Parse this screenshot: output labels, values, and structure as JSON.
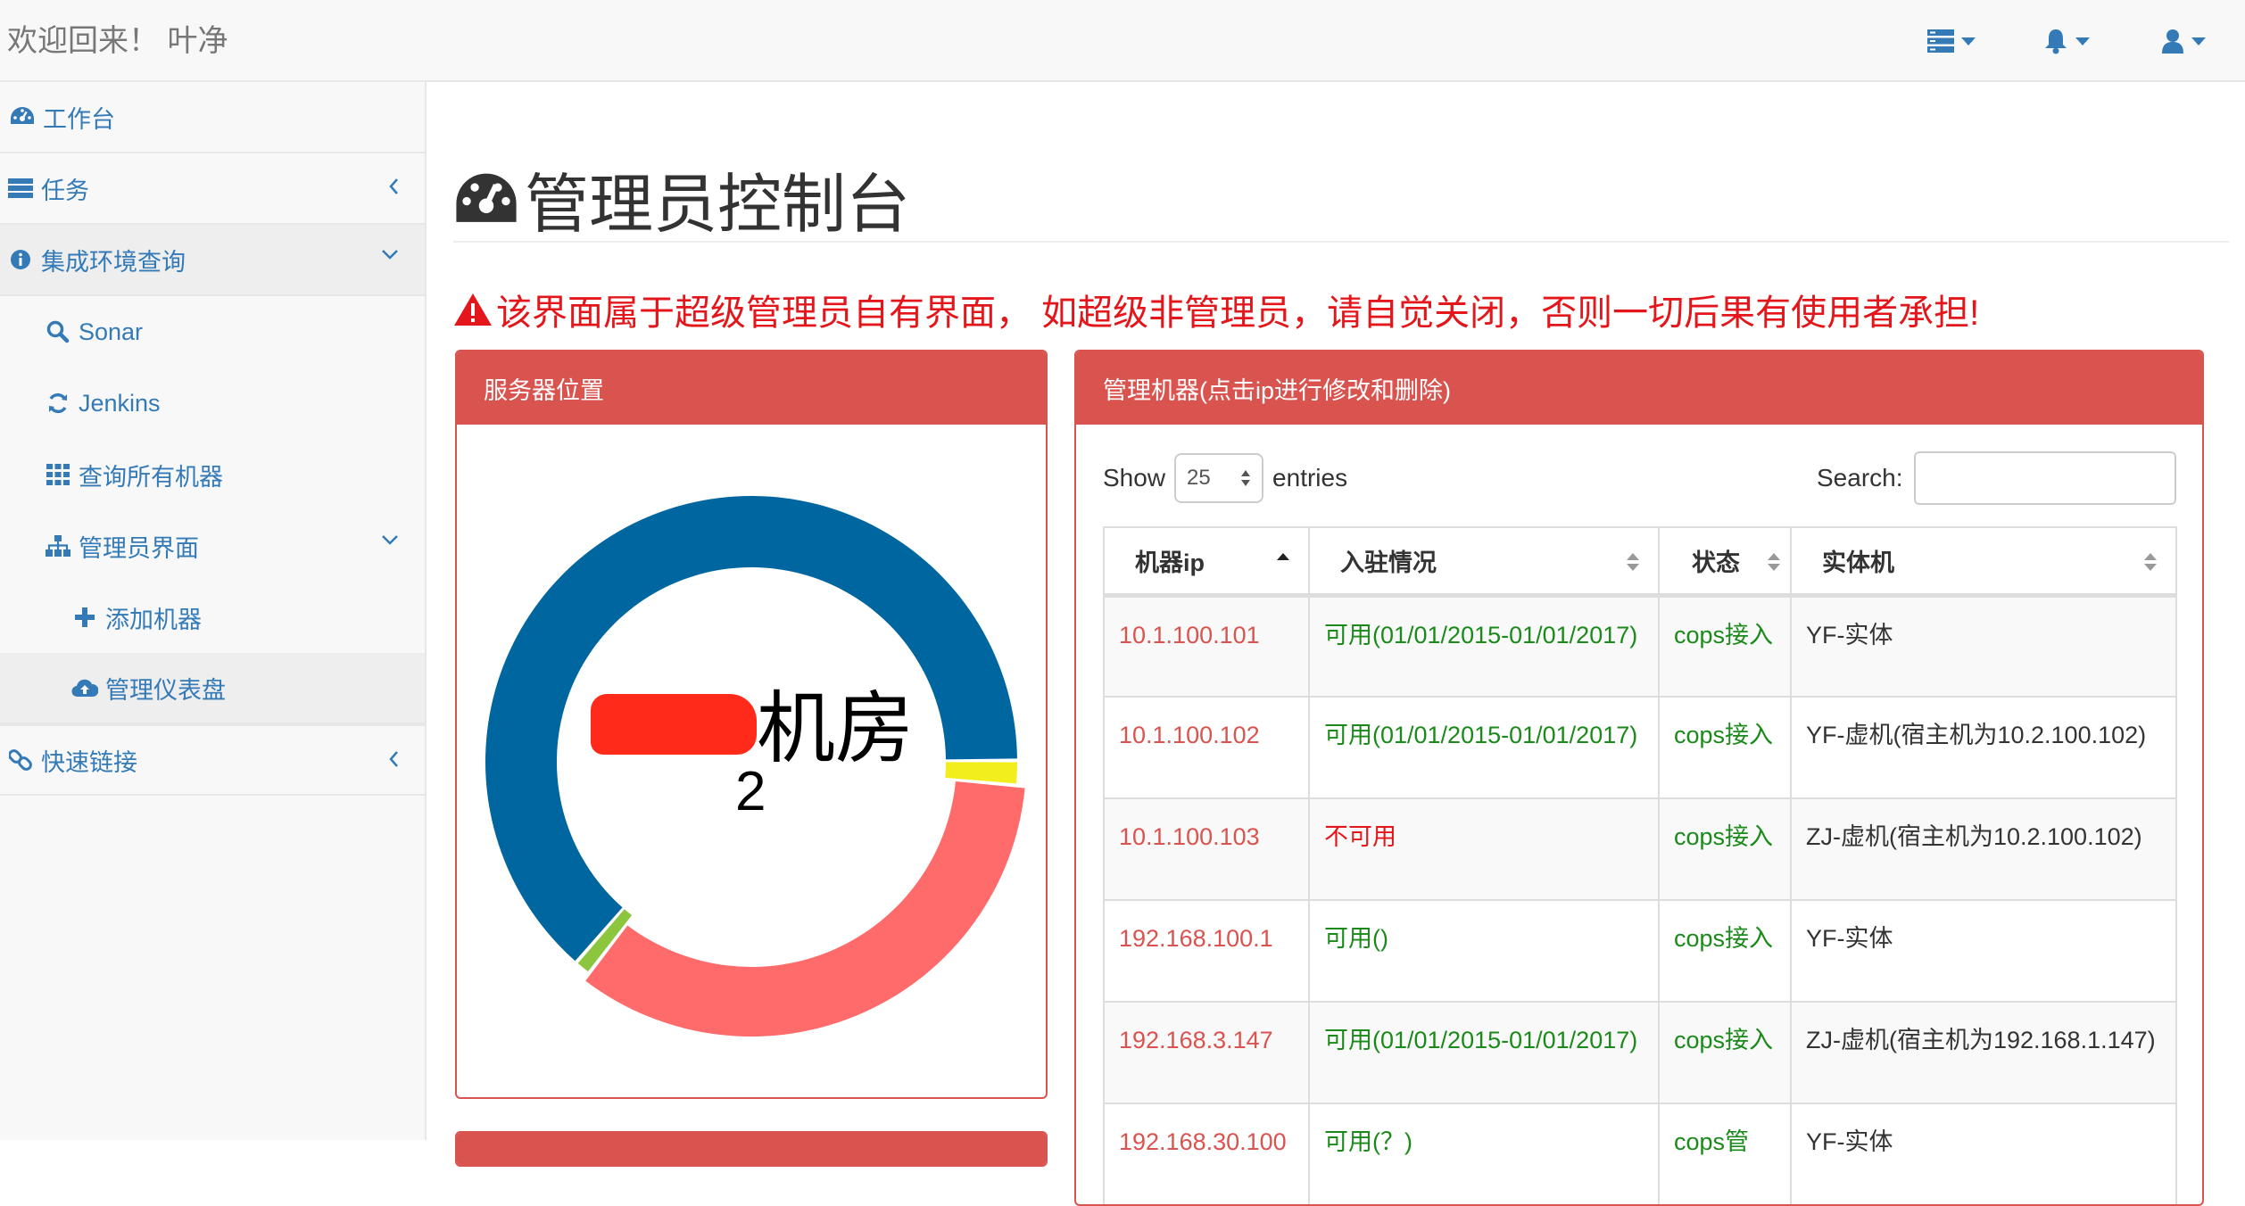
{
  "navbar": {
    "brand": "欢迎回来！ 叶净",
    "icons": [
      "tasks-menu-icon",
      "bell-icon",
      "user-icon"
    ]
  },
  "sidebar": {
    "items": [
      {
        "label": "工作台",
        "icon": "dashboard-icon"
      },
      {
        "label": "任务",
        "icon": "tasks-icon"
      },
      {
        "label": "集成环境查询",
        "icon": "info-circle-icon"
      },
      {
        "label": "Sonar",
        "icon": "search-icon"
      },
      {
        "label": "Jenkins",
        "icon": "refresh-icon"
      },
      {
        "label": "查询所有机器",
        "icon": "grid-icon"
      },
      {
        "label": "管理员界面",
        "icon": "sitemap-icon"
      },
      {
        "label": "添加机器",
        "icon": "plus-icon"
      },
      {
        "label": "管理仪表盘",
        "icon": "cloud-upload-icon"
      },
      {
        "label": "快速链接",
        "icon": "link-icon"
      }
    ]
  },
  "main": {
    "title": "管理员控制台",
    "warning": "该界面属于超级管理员自有界面， 如超级非管理员，请自觉关闭，否则一切后果有使用者承担!"
  },
  "server_panel": {
    "heading": "服务器位置",
    "center_title": "机房",
    "center_value": "2",
    "chart_data": {
      "type": "pie",
      "segments": [
        {
          "value": 63.5,
          "color": "#00669f"
        },
        {
          "value": 1.5,
          "color": "#f2ee1e"
        },
        {
          "value": 34,
          "color": "#ff6a6a"
        },
        {
          "value": 1,
          "color": "#8cc63f"
        }
      ]
    }
  },
  "machines_panel": {
    "heading": "管理机器(点击ip进行修改和删除)",
    "show_label": "Show",
    "page_length": "25",
    "entries_label": "entries",
    "search_label": "Search:",
    "columns": [
      "机器ip",
      "入驻情况",
      "状态",
      "实体机"
    ],
    "rows": [
      {
        "ip": "10.1.100.101",
        "status": "可用(01/01/2015-01/01/2017)",
        "state": "cops接入",
        "host": "YF-实体"
      },
      {
        "ip": "10.1.100.102",
        "status": "可用(01/01/2015-01/01/2017)",
        "state": "cops接入",
        "host": "YF-虚机(宿主机为10.2.100.102)"
      },
      {
        "ip": "10.1.100.103",
        "status": "不可用",
        "state": "cops接入",
        "host": "ZJ-虚机(宿主机为10.2.100.102)"
      },
      {
        "ip": "192.168.100.1",
        "status": "可用()",
        "state": "cops接入",
        "host": "YF-实体"
      },
      {
        "ip": "192.168.3.147",
        "status": "可用(01/01/2015-01/01/2017)",
        "state": "cops接入",
        "host": "ZJ-虚机(宿主机为192.168.1.147)"
      },
      {
        "ip": "192.168.30.100",
        "status": "可用(？)",
        "state": "cops管",
        "host": "YF-实体"
      }
    ]
  },
  "colors": {
    "link": "#337ab7",
    "danger": "#d9534f",
    "warning_text": "#e3171b",
    "available_text": "#1a8a1a"
  }
}
